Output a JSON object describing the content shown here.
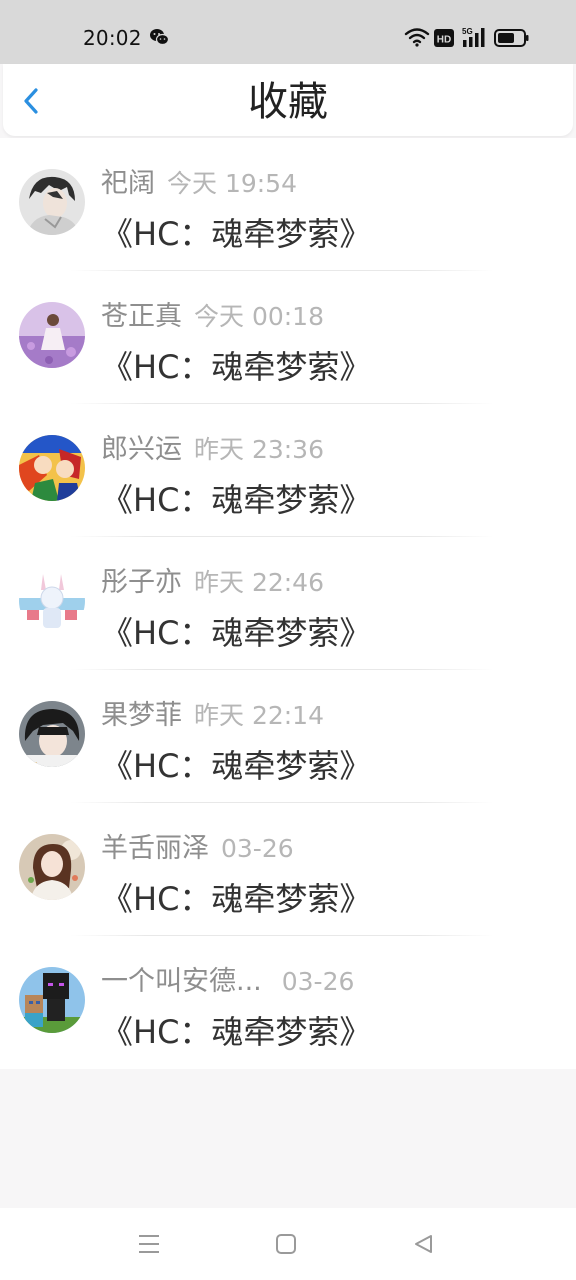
{
  "status_bar": {
    "time": "20:02",
    "icons": [
      "wechat-icon",
      "wifi-icon",
      "hd-icon",
      "5g-signal-icon",
      "battery-icon"
    ],
    "hd_text": "HD",
    "network_text": "5G"
  },
  "header": {
    "title": "收藏",
    "back_icon": "chevron-left-icon",
    "accent_color": "#2b8fe0"
  },
  "favorites": [
    {
      "user": "祀阔",
      "time": "今天 19:54",
      "book": "《HC：魂牵梦萦》"
    },
    {
      "user": "苍正真",
      "time": "今天 00:18",
      "book": "《HC：魂牵梦萦》"
    },
    {
      "user": "郎兴运",
      "time": "昨天 23:36",
      "book": "《HC：魂牵梦萦》"
    },
    {
      "user": "彤子亦",
      "time": "昨天 22:46",
      "book": "《HC：魂牵梦萦》"
    },
    {
      "user": "果梦菲",
      "time": "昨天 22:14",
      "book": "《HC：魂牵梦萦》"
    },
    {
      "user": "羊舌丽泽",
      "time": "03-26",
      "book": "《HC：魂牵梦萦》"
    },
    {
      "user": "一个叫安德...",
      "time": "03-26",
      "book": "《HC：魂牵梦萦》"
    }
  ],
  "nav_bar": {
    "buttons": [
      "menu-icon",
      "home-square-icon",
      "back-triangle-icon"
    ]
  }
}
